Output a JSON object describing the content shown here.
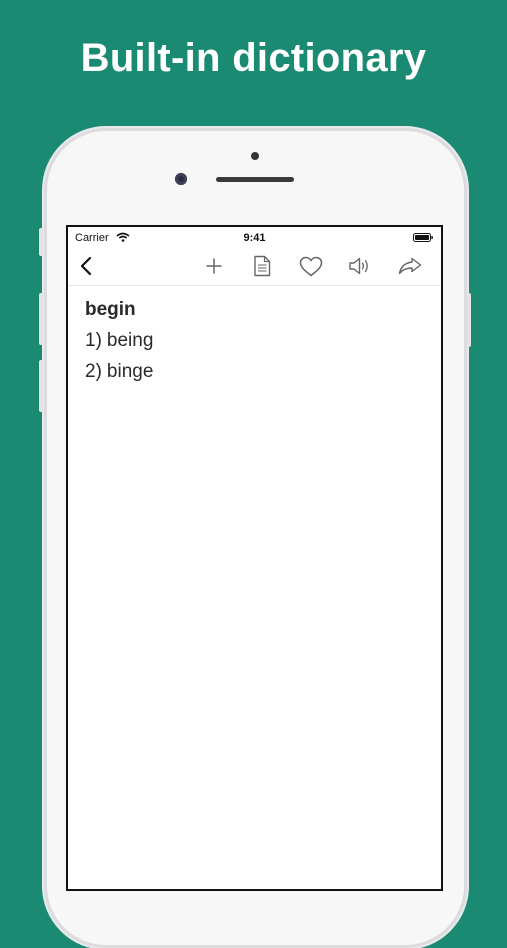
{
  "promo": {
    "headline": "Built-in dictionary"
  },
  "status_bar": {
    "carrier": "Carrier",
    "time": "9:41"
  },
  "toolbar": {
    "icons": [
      "back-chevron-icon",
      "plus-icon",
      "document-icon",
      "heart-icon",
      "speaker-icon",
      "share-icon"
    ]
  },
  "entry": {
    "word": "begin",
    "results": [
      {
        "num": "1)",
        "word": "being"
      },
      {
        "num": "2)",
        "word": "binge"
      }
    ]
  },
  "colors": {
    "background": "#1a8b72",
    "icon_gray": "#666666"
  }
}
